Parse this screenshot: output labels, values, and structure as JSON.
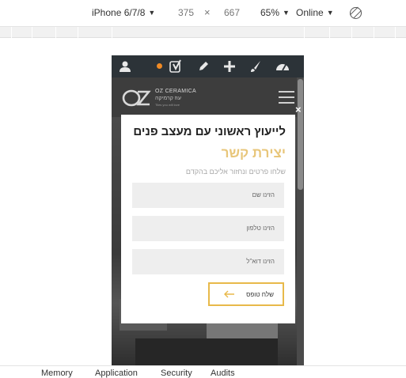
{
  "devtools": {
    "device": "iPhone 6/7/8",
    "width": "375",
    "times": "×",
    "height": "667",
    "zoom": "65%",
    "throttle": "Online"
  },
  "admin_bar": {
    "icons": [
      "user-icon",
      "yoast-icon",
      "pencil-icon",
      "plus-icon",
      "brush-icon",
      "dashboard-icon"
    ],
    "notification_color": "#f08a24"
  },
  "site": {
    "logo_line1": "OZ CERAMICA",
    "logo_line2": "עוז קרמיקה",
    "logo_line3": "Tiles you will love"
  },
  "modal": {
    "close": "×",
    "title": "לייעוץ ראשוני עם מעצב פנים",
    "subtitle": "יצירת קשר",
    "description": "שלחו פרטים ונחזור אליכם בהקדם",
    "name_placeholder": "הזינו שם",
    "phone_placeholder": "הזינו טלפון",
    "email_placeholder": "הזינו דוא\"ל",
    "submit_label": "שלח טופס",
    "accent_color": "#e8c67a",
    "button_border_color": "#e8b94a"
  },
  "bottom_tabs": [
    "Memory",
    "Application",
    "Security",
    "Audits"
  ]
}
